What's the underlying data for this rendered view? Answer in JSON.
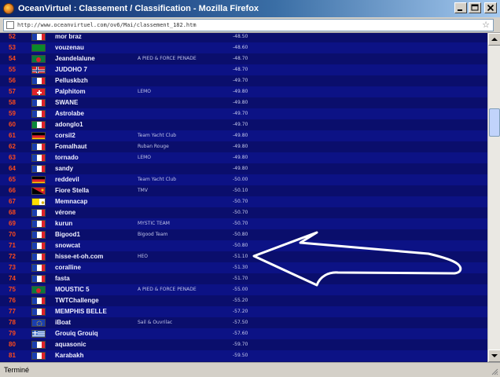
{
  "window": {
    "title": "OceanVirtuel : Classement / Classification - Mozilla Firefox"
  },
  "address_bar": {
    "url": "http://www.oceanvirtuel.com/ov6/Mai/classement_182.htm"
  },
  "status_bar": {
    "text": "Terminé"
  },
  "colors": {
    "table_background": "#0c0f70",
    "rank_text": "#ff4a1a",
    "annotation_arrow": "#ffffff"
  },
  "rows": [
    {
      "rank": "52",
      "flag": "france",
      "name": "mor braz",
      "team": "",
      "score": "-48.50"
    },
    {
      "rank": "53",
      "flag": "green",
      "name": "vouzenau",
      "team": "",
      "score": "-48.60"
    },
    {
      "rank": "54",
      "flag": "bangladesh",
      "name": "Jeandelalune",
      "team": "A PIED & FORCE PENADE",
      "score": "-48.70"
    },
    {
      "rank": "55",
      "flag": "norway",
      "name": "JUDOHO 7",
      "team": "",
      "score": "-48.70"
    },
    {
      "rank": "56",
      "flag": "france",
      "name": "Pelluskbzh",
      "team": "",
      "score": "-49.70"
    },
    {
      "rank": "57",
      "flag": "switzerland",
      "name": "Palphitom",
      "team": "LEMO",
      "score": "-49.80"
    },
    {
      "rank": "58",
      "flag": "france",
      "name": "SWANE",
      "team": "",
      "score": "-49.80"
    },
    {
      "rank": "59",
      "flag": "france",
      "name": "Astrolabe",
      "team": "",
      "score": "-49.70"
    },
    {
      "rank": "60",
      "flag": "italy",
      "name": "adonglo1",
      "team": "",
      "score": "-49.70"
    },
    {
      "rank": "61",
      "flag": "germany",
      "name": "corsil2",
      "team": "Team Yacht Club",
      "score": "-49.80"
    },
    {
      "rank": "62",
      "flag": "france",
      "name": "Fomalhaut",
      "team": "Ruban Rouge",
      "score": "-49.80"
    },
    {
      "rank": "63",
      "flag": "france",
      "name": "tornado",
      "team": "LEMO",
      "score": "-49.80"
    },
    {
      "rank": "64",
      "flag": "france",
      "name": "sandy",
      "team": "",
      "score": "-49.80"
    },
    {
      "rank": "65",
      "flag": "germany",
      "name": "reddevil",
      "team": "Team Yacht Club",
      "score": "-50.00"
    },
    {
      "rank": "66",
      "flag": "papua",
      "name": "Fiore Stella",
      "team": "TMV",
      "score": "-50.10"
    },
    {
      "rank": "67",
      "flag": "vatican",
      "name": "Memnacap",
      "team": "",
      "score": "-50.70"
    },
    {
      "rank": "68",
      "flag": "france",
      "name": "vérone",
      "team": "",
      "score": "-50.70"
    },
    {
      "rank": "69",
      "flag": "france",
      "name": "kurun",
      "team": "MYSTIC TEAM",
      "score": "-50.70"
    },
    {
      "rank": "70",
      "flag": "france",
      "name": "Bigood1",
      "team": "Bigood Team",
      "score": "-50.80"
    },
    {
      "rank": "71",
      "flag": "france",
      "name": "snowcat",
      "team": "",
      "score": "-50.80"
    },
    {
      "rank": "72",
      "flag": "france",
      "name": "hisse-et-oh.com",
      "team": "HEO",
      "score": "-51.10"
    },
    {
      "rank": "73",
      "flag": "france",
      "name": "coralline",
      "team": "",
      "score": "-51.30"
    },
    {
      "rank": "74",
      "flag": "france",
      "name": "fasta",
      "team": "",
      "score": "-51.70"
    },
    {
      "rank": "75",
      "flag": "bangladesh",
      "name": "MOUSTIC 5",
      "team": "A PIED & FORCE PENADE",
      "score": "-55.00"
    },
    {
      "rank": "76",
      "flag": "france",
      "name": "TWTChallenge",
      "team": "",
      "score": "-55.20"
    },
    {
      "rank": "77",
      "flag": "france",
      "name": "MEMPHIS BELLE",
      "team": "",
      "score": "-57.20"
    },
    {
      "rank": "78",
      "flag": "europe",
      "name": "iBoat",
      "team": "Sail & Ouvrilac",
      "score": "-57.50"
    },
    {
      "rank": "79",
      "flag": "greece",
      "name": "Grouiq Grouiq",
      "team": "",
      "score": "-57.60"
    },
    {
      "rank": "80",
      "flag": "france",
      "name": "aquasonic",
      "team": "",
      "score": "-59.70"
    },
    {
      "rank": "81",
      "flag": "france",
      "name": "Karabakh",
      "team": "",
      "score": "-59.50"
    }
  ]
}
